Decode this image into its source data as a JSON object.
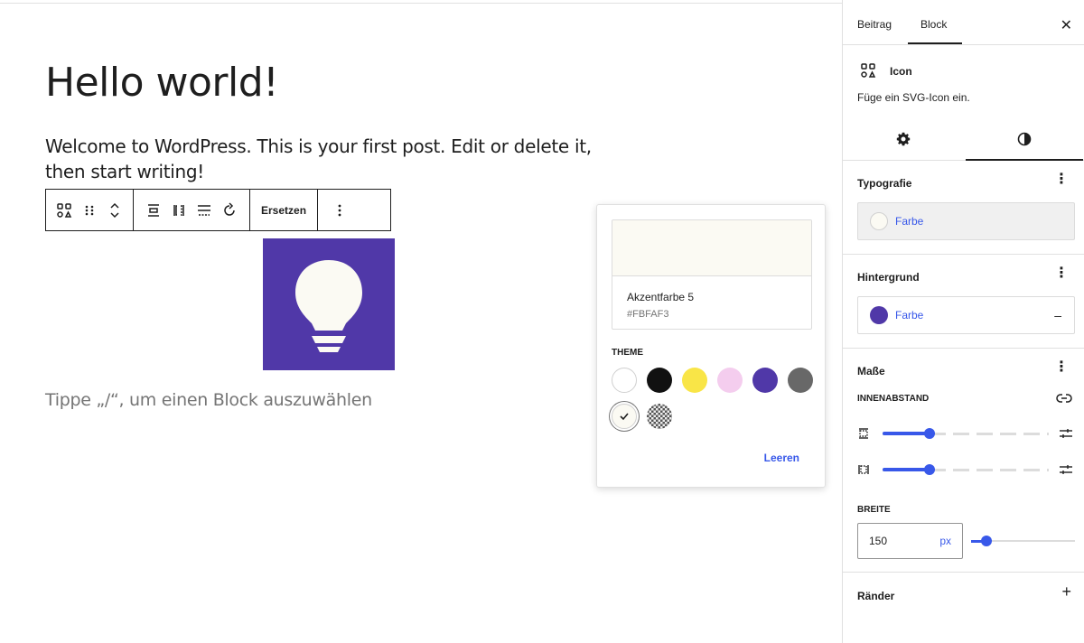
{
  "post": {
    "title": "Hello world!",
    "paragraph": "Welcome to WordPress. This is your first post. Edit or delete it, then start writing!",
    "placeholder": "Tippe „/“, um einen Block auszuwählen"
  },
  "toolbar": {
    "replace_label": "Ersetzen"
  },
  "icon_block": {
    "icon": "lightbulb-icon",
    "background": "#5038a8",
    "color": "#FBFAF3"
  },
  "color_popover": {
    "selected_name": "Akzentfarbe 5",
    "selected_hex": "#FBFAF3",
    "theme_label": "THEME",
    "clear_label": "Leeren",
    "swatches": [
      {
        "name": "white",
        "color": "#ffffff"
      },
      {
        "name": "black",
        "color": "#111111"
      },
      {
        "name": "yellow",
        "color": "#f9e547"
      },
      {
        "name": "pink",
        "color": "#f4cdee"
      },
      {
        "name": "purple",
        "color": "#5038a8"
      },
      {
        "name": "gray",
        "color": "#686868"
      },
      {
        "name": "accent-5",
        "color": "#FBFAF3",
        "selected": true
      },
      {
        "name": "pattern",
        "color": "pattern"
      }
    ]
  },
  "sidebar": {
    "tabs": [
      "Beitrag",
      "Block"
    ],
    "active_tab": "Block",
    "block": {
      "name": "Icon",
      "description": "Füge ein SVG-Icon ein."
    },
    "typography": {
      "title": "Typografie",
      "color_label": "Farbe",
      "color": "#FBFAF3"
    },
    "background": {
      "title": "Hintergrund",
      "color_label": "Farbe",
      "color": "#5038a8",
      "reset_symbol": "–"
    },
    "dimensions": {
      "title": "Maße",
      "padding_label": "INNENABSTAND",
      "width_label": "BREITE",
      "width_value": "150",
      "width_unit": "px"
    },
    "borders": {
      "title": "Ränder",
      "add_symbol": "+"
    }
  }
}
